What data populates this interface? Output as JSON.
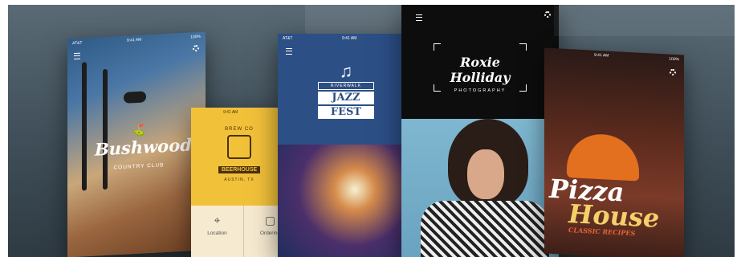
{
  "status": {
    "carrier": "AT&T",
    "time": "9:41 AM",
    "battery": "100%"
  },
  "bushwood": {
    "logo": "Bushwood",
    "subtitle": "COUNTRY CLUB"
  },
  "beerhouse": {
    "top": "BREW CO",
    "name": "BEERHOUSE",
    "location": "AUSTIN, TX",
    "buttons": [
      {
        "label": "Location",
        "icon": "map-pin-icon"
      },
      {
        "label": "Ordering",
        "icon": "shopping-bag-icon"
      }
    ]
  },
  "jazz": {
    "small": "RIVERWALK",
    "line1": "JAZZ",
    "line2": "FEST"
  },
  "roxie": {
    "logo": "Roxie Holliday",
    "sub": "PHOTOGRAPHY"
  },
  "pizza": {
    "line1": "Pizza",
    "line2": "House",
    "sub": "CLASSIC RECIPES"
  }
}
